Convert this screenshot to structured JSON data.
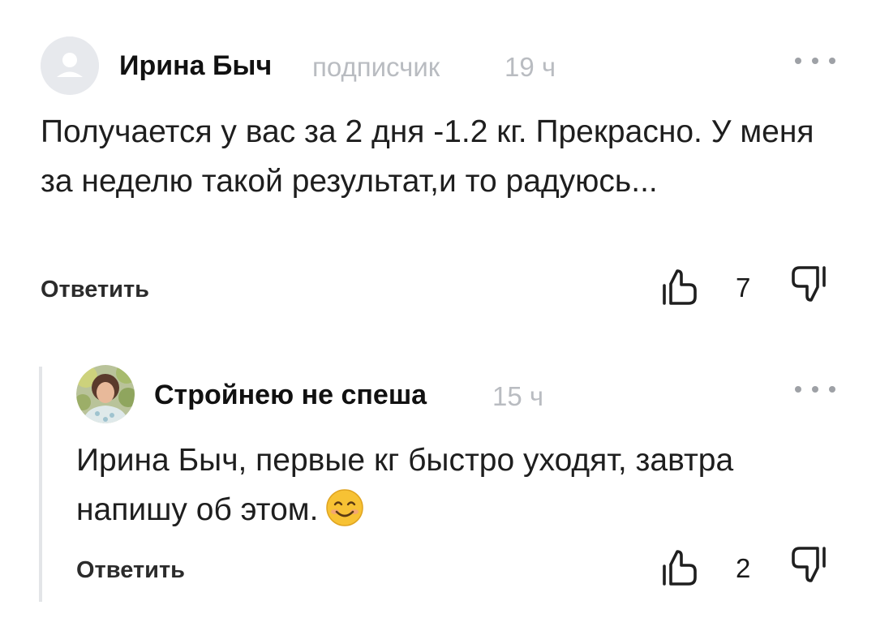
{
  "comment": {
    "author": "Ирина Быч",
    "badge": "подписчик",
    "time": "19 ч",
    "text": "Получается у вас за 2 дня -1.2 кг. Прекрасно. У меня за неделю такой результат,и то радуюсь...",
    "reply_label": "Ответить",
    "likes": "7",
    "avatar_icon": "user-placeholder-icon",
    "more_icon": "more-dots-icon"
  },
  "reply": {
    "author": "Стройнею не спеша",
    "time": "15 ч",
    "text": "Ирина Быч, первые кг быстро уходят, завтра напишу об этом.",
    "emoji_icon": "smiling-face-emoji",
    "reply_label": "Ответить",
    "likes": "2",
    "avatar_icon": "author-photo",
    "more_icon": "more-dots-icon"
  },
  "colors": {
    "muted_text": "#b9bcc1",
    "thread_line": "#e3e5e8",
    "avatar_bg": "#e7e9ed"
  }
}
